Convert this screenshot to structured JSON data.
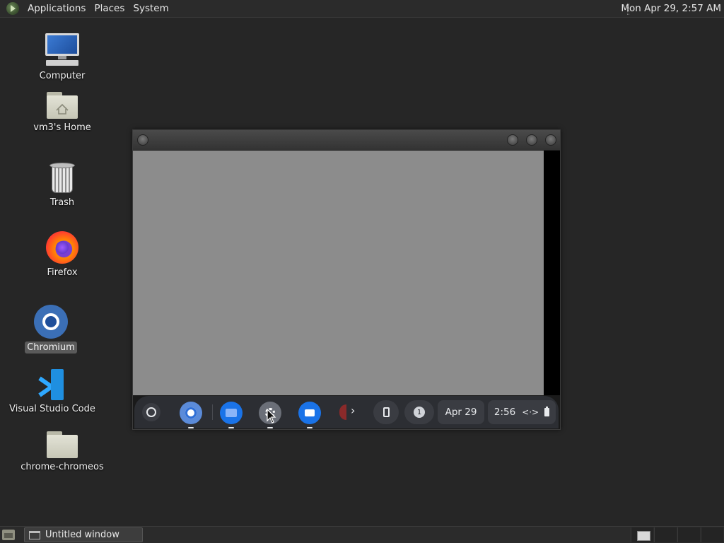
{
  "top_panel": {
    "menus": [
      "Applications",
      "Places",
      "System"
    ],
    "clock": "Mon Apr 29,  2:57 AM"
  },
  "desktop_icons": [
    {
      "label": "Computer",
      "icon": "computer-icon"
    },
    {
      "label": "vm3's Home",
      "icon": "home-folder-icon"
    },
    {
      "label": "Trash",
      "icon": "trash-icon"
    },
    {
      "label": "Firefox",
      "icon": "firefox-icon"
    },
    {
      "label": "Chromium",
      "icon": "chromium-icon",
      "selected": true
    },
    {
      "label": "Visual Studio Code",
      "icon": "vscode-icon"
    },
    {
      "label": "chrome-chromeos",
      "icon": "folder-icon"
    }
  ],
  "app_window": {
    "shelf": {
      "apps": [
        "chrome-icon",
        "files-icon",
        "settings-icon",
        "camera-icon"
      ],
      "chevron": "›",
      "notification_count": "1",
      "date": "Apr 29",
      "time": "2:56",
      "status_icons": "<·>"
    }
  },
  "bottom_panel": {
    "task": "Untitled window"
  },
  "colors": {
    "desktop_bg": "#262626",
    "panel_bg": "#2b2b2b",
    "window_content": "#8c8c8c",
    "shelf_bg": "#2c2e33"
  }
}
